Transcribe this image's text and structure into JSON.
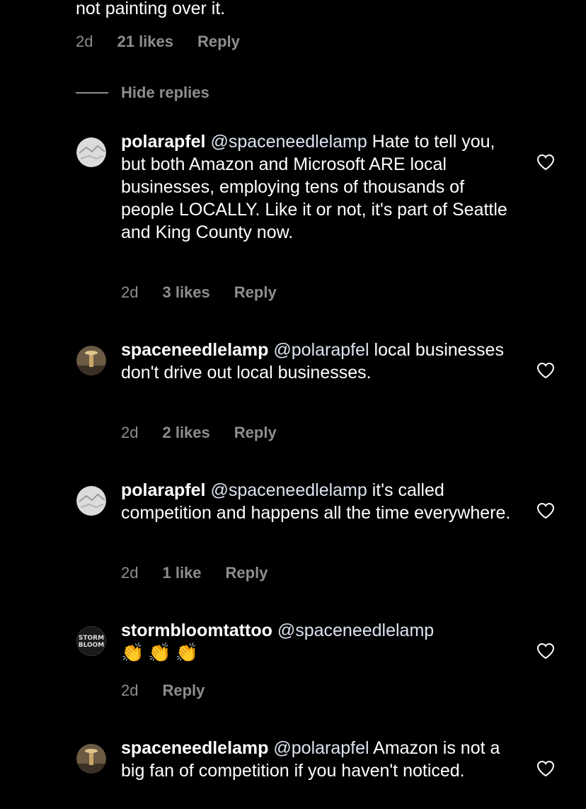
{
  "top_comment": {
    "text_tail": "not painting over it.",
    "time": "2d",
    "likes": "21 likes",
    "reply_label": "Reply"
  },
  "hide_replies_label": "Hide replies",
  "replies": [
    {
      "username": "polarapfel",
      "mention": "@spaceneedlelamp",
      "text": " Hate to tell you, but both Amazon and Microsoft ARE local businesses, employing tens of thousands of people LOCALLY. Like it or not, it's part of Seattle and King County now.",
      "time": "2d",
      "likes": "3 likes",
      "reply_label": "Reply",
      "avatar": "polarapfel-avatar"
    },
    {
      "username": "spaceneedlelamp",
      "mention": "@polarapfel",
      "text": " local businesses don't drive out local businesses.",
      "time": "2d",
      "likes": "2 likes",
      "reply_label": "Reply",
      "avatar": "spaceneedlelamp-avatar"
    },
    {
      "username": "polarapfel",
      "mention": "@spaceneedlelamp",
      "text": " it's called competition and happens all the time everywhere.",
      "time": "2d",
      "likes": "1 like",
      "reply_label": "Reply",
      "avatar": "polarapfel-avatar"
    },
    {
      "username": "stormbloomtattoo",
      "mention": "@spaceneedlelamp",
      "text": "👏👏👏",
      "time": "2d",
      "reply_label": "Reply",
      "avatar": "stormbloomtattoo-avatar",
      "avatar_text": [
        "STORM",
        "BLOOM"
      ]
    },
    {
      "username": "spaceneedlelamp",
      "mention": "@polarapfel",
      "text": " Amazon is not a big fan of competition if you haven't noticed.",
      "avatar": "spaceneedlelamp-avatar"
    }
  ],
  "colors": {
    "background": "#000000",
    "text": "#ffffff",
    "secondary": "#8e8e8e",
    "mention": "#dbe3f0"
  },
  "icons": {
    "like": "heart-outline-icon"
  }
}
